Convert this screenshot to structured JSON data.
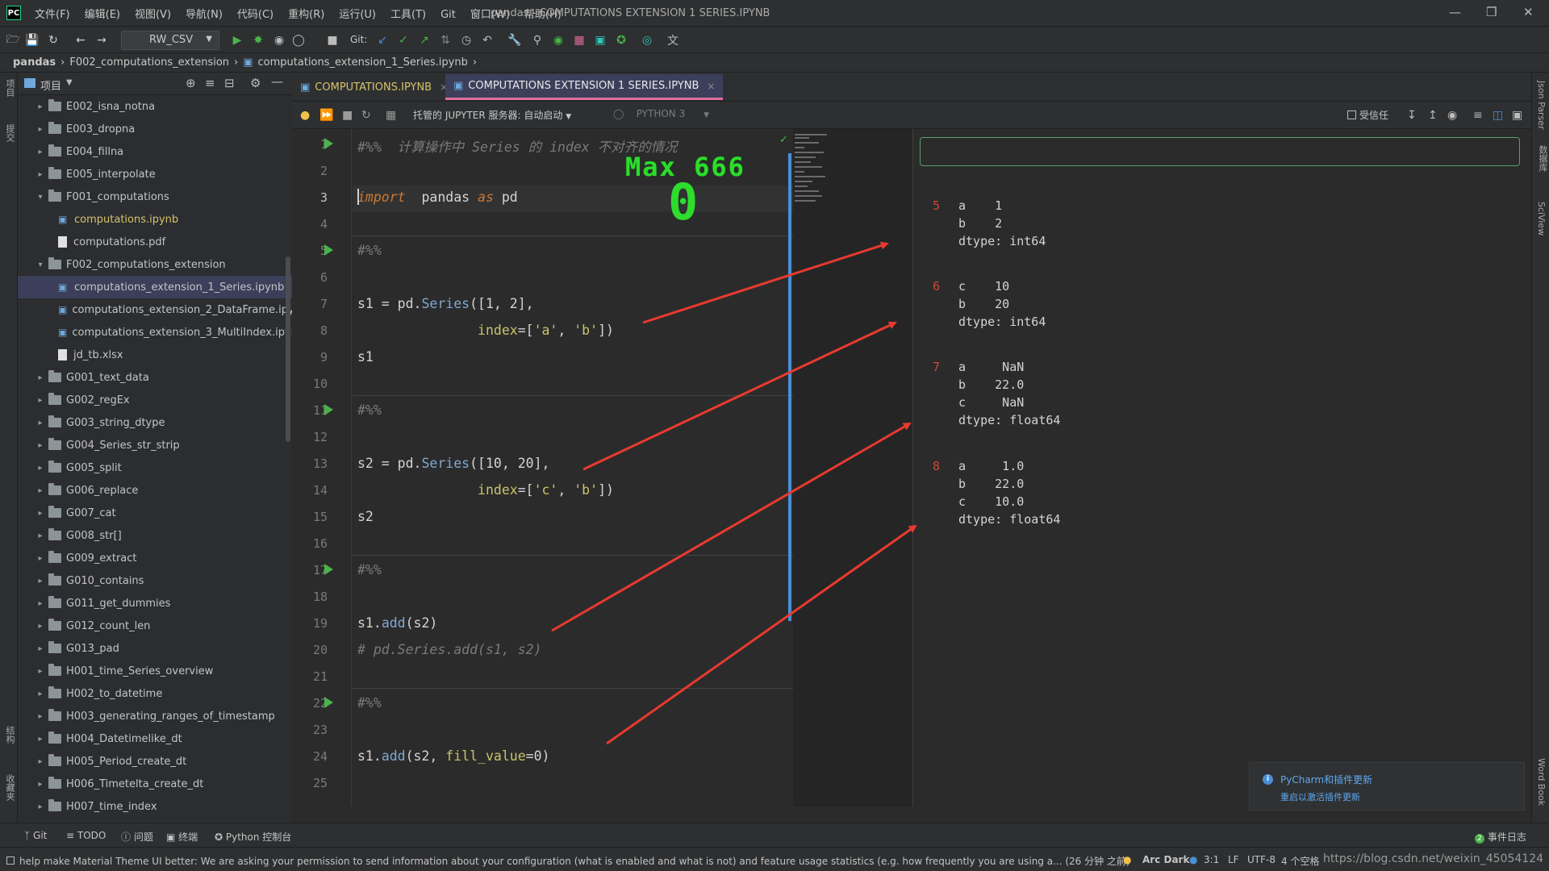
{
  "titlebar": {
    "menus": [
      "文件(F)",
      "编辑(E)",
      "视图(V)",
      "导航(N)",
      "代码(C)",
      "重构(R)",
      "运行(U)",
      "工具(T)",
      "Git",
      "窗口(W)",
      "帮助(H)"
    ],
    "window_title": "pandas - COMPUTATIONS EXTENSION 1 SERIES.IPYNB"
  },
  "toolbar": {
    "run_config": "RW_CSV",
    "git_label": "Git:"
  },
  "breadcrumb": [
    "pandas",
    "F002_computations_extension",
    "computations_extension_1_Series.ipynb"
  ],
  "project_panel": {
    "title": "项目",
    "items": [
      {
        "label": "E002_isna_notna",
        "type": "folder",
        "expanded": false,
        "depth": 1
      },
      {
        "label": "E003_dropna",
        "type": "folder",
        "expanded": false,
        "depth": 1
      },
      {
        "label": "E004_fillna",
        "type": "folder",
        "expanded": false,
        "depth": 1
      },
      {
        "label": "E005_interpolate",
        "type": "folder",
        "expanded": false,
        "depth": 1
      },
      {
        "label": "F001_computations",
        "type": "folder",
        "expanded": true,
        "depth": 1
      },
      {
        "label": "computations.ipynb",
        "type": "notebook",
        "depth": 2,
        "highlight": true
      },
      {
        "label": "computations.pdf",
        "type": "file",
        "depth": 2
      },
      {
        "label": "F002_computations_extension",
        "type": "folder",
        "expanded": true,
        "depth": 1
      },
      {
        "label": "computations_extension_1_Series.ipynb",
        "type": "notebook",
        "depth": 2,
        "selected": true
      },
      {
        "label": "computations_extension_2_DataFrame.ipynb",
        "type": "notebook",
        "depth": 2
      },
      {
        "label": "computations_extension_3_MultiIndex.ipynb",
        "type": "notebook",
        "depth": 2
      },
      {
        "label": "jd_tb.xlsx",
        "type": "file",
        "depth": 2
      },
      {
        "label": "G001_text_data",
        "type": "folder",
        "expanded": false,
        "depth": 1
      },
      {
        "label": "G002_regEx",
        "type": "folder",
        "expanded": false,
        "depth": 1
      },
      {
        "label": "G003_string_dtype",
        "type": "folder",
        "expanded": false,
        "depth": 1
      },
      {
        "label": "G004_Series_str_strip",
        "type": "folder",
        "expanded": false,
        "depth": 1
      },
      {
        "label": "G005_split",
        "type": "folder",
        "expanded": false,
        "depth": 1
      },
      {
        "label": "G006_replace",
        "type": "folder",
        "expanded": false,
        "depth": 1
      },
      {
        "label": "G007_cat",
        "type": "folder",
        "expanded": false,
        "depth": 1
      },
      {
        "label": "G008_str[]",
        "type": "folder",
        "expanded": false,
        "depth": 1
      },
      {
        "label": "G009_extract",
        "type": "folder",
        "expanded": false,
        "depth": 1
      },
      {
        "label": "G010_contains",
        "type": "folder",
        "expanded": false,
        "depth": 1
      },
      {
        "label": "G011_get_dummies",
        "type": "folder",
        "expanded": false,
        "depth": 1
      },
      {
        "label": "G012_count_len",
        "type": "folder",
        "expanded": false,
        "depth": 1
      },
      {
        "label": "G013_pad",
        "type": "folder",
        "expanded": false,
        "depth": 1
      },
      {
        "label": "H001_time_Series_overview",
        "type": "folder",
        "expanded": false,
        "depth": 1
      },
      {
        "label": "H002_to_datetime",
        "type": "folder",
        "expanded": false,
        "depth": 1
      },
      {
        "label": "H003_generating_ranges_of_timestamp",
        "type": "folder",
        "expanded": false,
        "depth": 1
      },
      {
        "label": "H004_Datetimelike_dt",
        "type": "folder",
        "expanded": false,
        "depth": 1
      },
      {
        "label": "H005_Period_create_dt",
        "type": "folder",
        "expanded": false,
        "depth": 1
      },
      {
        "label": "H006_Timetelta_create_dt",
        "type": "folder",
        "expanded": false,
        "depth": 1
      },
      {
        "label": "H007_time_index",
        "type": "folder",
        "expanded": false,
        "depth": 1
      }
    ]
  },
  "tabs": [
    {
      "label": "COMPUTATIONS.IPYNB",
      "active": false
    },
    {
      "label": "COMPUTATIONS EXTENSION 1 SERIES.IPYNB",
      "active": true
    }
  ],
  "notebook_bar": {
    "server": "托管的 JUPYTER 服务器: 自动启动",
    "kernel": "PYTHON 3",
    "trusted": "受信任"
  },
  "code": {
    "current_line": 3,
    "lines": [
      {
        "n": 1,
        "run": true,
        "parts": [
          [
            "cm",
            "#%%  计算操作中 Series 的 index 不对齐的情况"
          ]
        ]
      },
      {
        "n": 2,
        "parts": []
      },
      {
        "n": 3,
        "parts": [
          [
            "kw",
            "import"
          ],
          [
            "",
            "  pandas "
          ],
          [
            "kw",
            "as"
          ],
          [
            "",
            " pd"
          ]
        ]
      },
      {
        "n": 4,
        "parts": []
      },
      {
        "n": 5,
        "run": true,
        "parts": [
          [
            "cm",
            "#%%"
          ]
        ]
      },
      {
        "n": 6,
        "parts": []
      },
      {
        "n": 7,
        "parts": [
          [
            "",
            "s1 = pd."
          ],
          [
            "fn",
            "Series"
          ],
          [
            "",
            "([1, 2],"
          ]
        ]
      },
      {
        "n": 8,
        "parts": [
          [
            "",
            "               "
          ],
          [
            "prm",
            "index"
          ],
          [
            "",
            "=["
          ],
          [
            "str",
            "'a'"
          ],
          [
            "",
            ", "
          ],
          [
            "str",
            "'b'"
          ],
          [
            "",
            "])"
          ]
        ]
      },
      {
        "n": 9,
        "parts": [
          [
            "",
            "s1"
          ]
        ]
      },
      {
        "n": 10,
        "parts": []
      },
      {
        "n": 11,
        "run": true,
        "parts": [
          [
            "cm",
            "#%%"
          ]
        ]
      },
      {
        "n": 12,
        "parts": []
      },
      {
        "n": 13,
        "parts": [
          [
            "",
            "s2 = pd."
          ],
          [
            "fn",
            "Series"
          ],
          [
            "",
            "([10, 20],"
          ]
        ]
      },
      {
        "n": 14,
        "parts": [
          [
            "",
            "               "
          ],
          [
            "prm",
            "index"
          ],
          [
            "",
            "=["
          ],
          [
            "str",
            "'c'"
          ],
          [
            "",
            ", "
          ],
          [
            "str",
            "'b'"
          ],
          [
            "",
            "])"
          ]
        ]
      },
      {
        "n": 15,
        "parts": [
          [
            "",
            "s2"
          ]
        ]
      },
      {
        "n": 16,
        "parts": []
      },
      {
        "n": 17,
        "run": true,
        "parts": [
          [
            "cm",
            "#%%"
          ]
        ]
      },
      {
        "n": 18,
        "parts": []
      },
      {
        "n": 19,
        "parts": [
          [
            "",
            "s1."
          ],
          [
            "fn",
            "add"
          ],
          [
            "",
            "(s2)"
          ]
        ]
      },
      {
        "n": 20,
        "parts": [
          [
            "cm",
            "# pd.Series.add(s1, s2)"
          ]
        ]
      },
      {
        "n": 21,
        "parts": []
      },
      {
        "n": 22,
        "run": true,
        "parts": [
          [
            "cm",
            "#%%"
          ]
        ]
      },
      {
        "n": 23,
        "parts": []
      },
      {
        "n": 24,
        "parts": [
          [
            "",
            "s1."
          ],
          [
            "fn",
            "add"
          ],
          [
            "",
            "(s2, "
          ],
          [
            "prm",
            "fill_value"
          ],
          [
            "",
            "=0)"
          ]
        ]
      },
      {
        "n": 25,
        "parts": []
      }
    ]
  },
  "overlay": {
    "max_label": "Max 666",
    "zero_label": "0"
  },
  "outputs": [
    {
      "n": "5",
      "text": "a    1\nb    2\ndtype: int64"
    },
    {
      "n": "6",
      "text": "c    10\nb    20\ndtype: int64"
    },
    {
      "n": "7",
      "text": "a     NaN\nb    22.0\nc     NaN\ndtype: float64"
    },
    {
      "n": "8",
      "text": "a     1.0\nb    22.0\nc    10.0\ndtype: float64"
    }
  ],
  "right_strip": [
    "Json Parser",
    "数据库",
    "SciView",
    "Word Book"
  ],
  "left_strip": [
    "项目",
    "提交",
    "结构",
    "收藏夹"
  ],
  "notification": {
    "title": "PyCharm和插件更新",
    "link": "重启以激活插件更新"
  },
  "tool_windows": [
    "Git",
    "TODO",
    "问题",
    "终端",
    "Python 控制台"
  ],
  "event_log": "事件日志",
  "status": {
    "message": "help make Material Theme UI better: We are asking your permission to send information about your configuration (what is enabled and what is not) and feature usage statistics (e.g. how frequently you are using a... (26 分钟 之前)",
    "theme": "Arc Dark",
    "position": "3:1",
    "line_sep": "LF",
    "encoding": "UTF-8",
    "indent": "4 个空格",
    "watermark": "https://blog.csdn.net/weixin_45054124"
  }
}
